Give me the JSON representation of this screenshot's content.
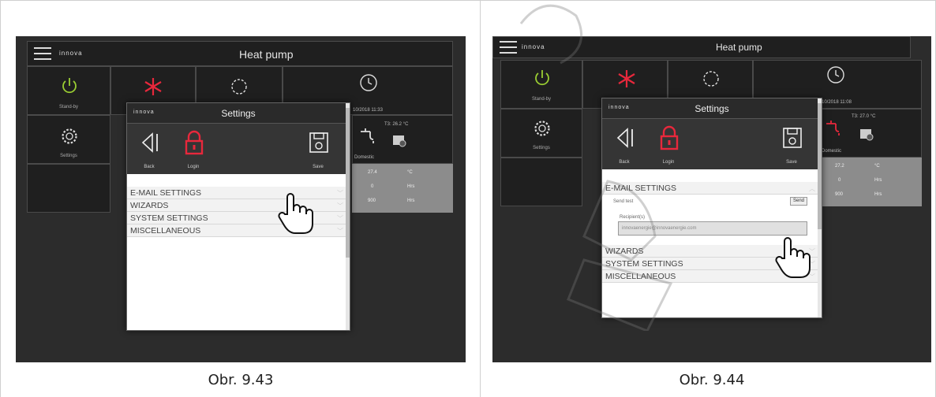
{
  "colors": {
    "accent_red": "#e8283c",
    "power_green": "#9acd32",
    "panel_bg": "#2c2c2c"
  },
  "figures": [
    {
      "caption": "Obr. 9.43",
      "app": {
        "logo": "innova",
        "title": "Heat pump",
        "standby_label": "Stand-by",
        "settings_label": "Settings",
        "datetime": "10/2018 11:33",
        "temp_label": "T3: 26.2 °C",
        "domestic_label": "Domestic",
        "table": [
          [
            "27.4",
            "°C"
          ],
          [
            "0",
            "Hrs"
          ],
          [
            "900",
            "Hrs"
          ]
        ]
      },
      "dialog": {
        "logo": "innova",
        "title": "Settings",
        "back_label": "Back",
        "login_label": "Login",
        "save_label": "Save",
        "menu": [
          "E-MAIL SETTINGS",
          "WIZARDS",
          "SYSTEM SETTINGS",
          "MISCELLANEOUS"
        ]
      }
    },
    {
      "caption": "Obr. 9.44",
      "app": {
        "logo": "innova",
        "title": "Heat pump",
        "standby_label": "Stand-by",
        "settings_label": "Settings",
        "datetime": "10/2018 11:08",
        "temp_label": "T3: 27.0 °C",
        "domestic_label": "Domestic",
        "table": [
          [
            "27.2",
            "°C"
          ],
          [
            "0",
            "Hrs"
          ],
          [
            "900",
            "Hrs"
          ]
        ]
      },
      "dialog": {
        "logo": "innova",
        "title": "Settings",
        "back_label": "Back",
        "login_label": "Login",
        "save_label": "Save",
        "email_section": "E-MAIL SETTINGS",
        "send_test_label": "Send test",
        "send_button": "Send",
        "recipient_label": "Recipient(s)",
        "recipient_value": "innovaenergie@innovaenergie.com",
        "menu": [
          "WIZARDS",
          "SYSTEM SETTINGS",
          "MISCELLANEOUS"
        ]
      }
    }
  ]
}
